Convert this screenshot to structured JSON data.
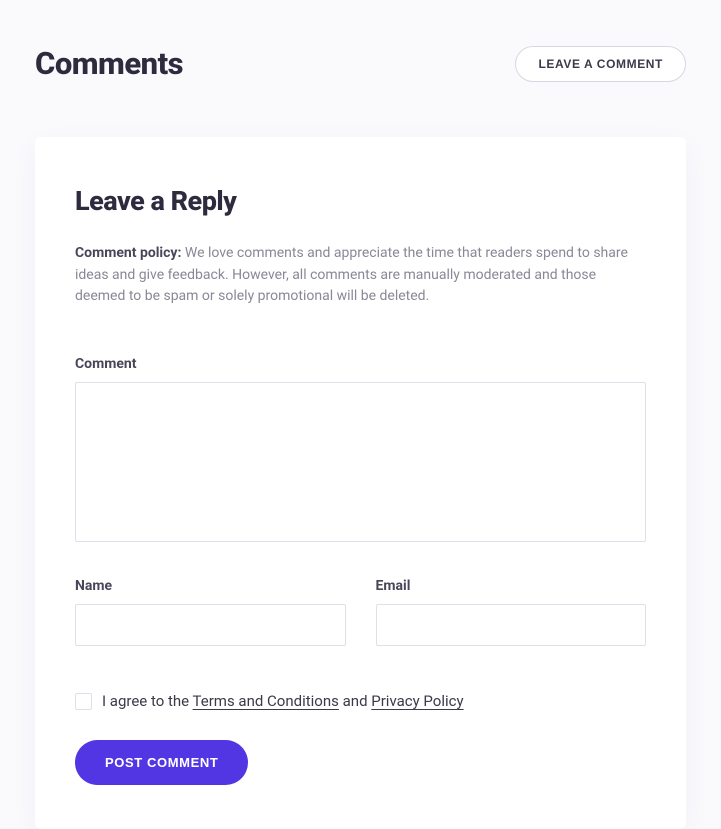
{
  "header": {
    "title": "Comments",
    "leave_comment_btn": "LEAVE A COMMENT"
  },
  "form": {
    "title": "Leave a Reply",
    "policy_label": "Comment policy:",
    "policy_text": " We love comments and appreciate the time that readers spend to share ideas and give feedback. However, all comments are manually moderated and those deemed to be spam or solely promotional will be deleted.",
    "comment_label": "Comment",
    "comment_value": "",
    "name_label": "Name",
    "name_value": "",
    "email_label": "Email",
    "email_value": "",
    "agree_prefix": "I agree to the ",
    "agree_terms": "Terms and Conditions",
    "agree_mid": " and ",
    "agree_privacy": "Privacy Policy",
    "submit_label": "POST COMMENT"
  }
}
